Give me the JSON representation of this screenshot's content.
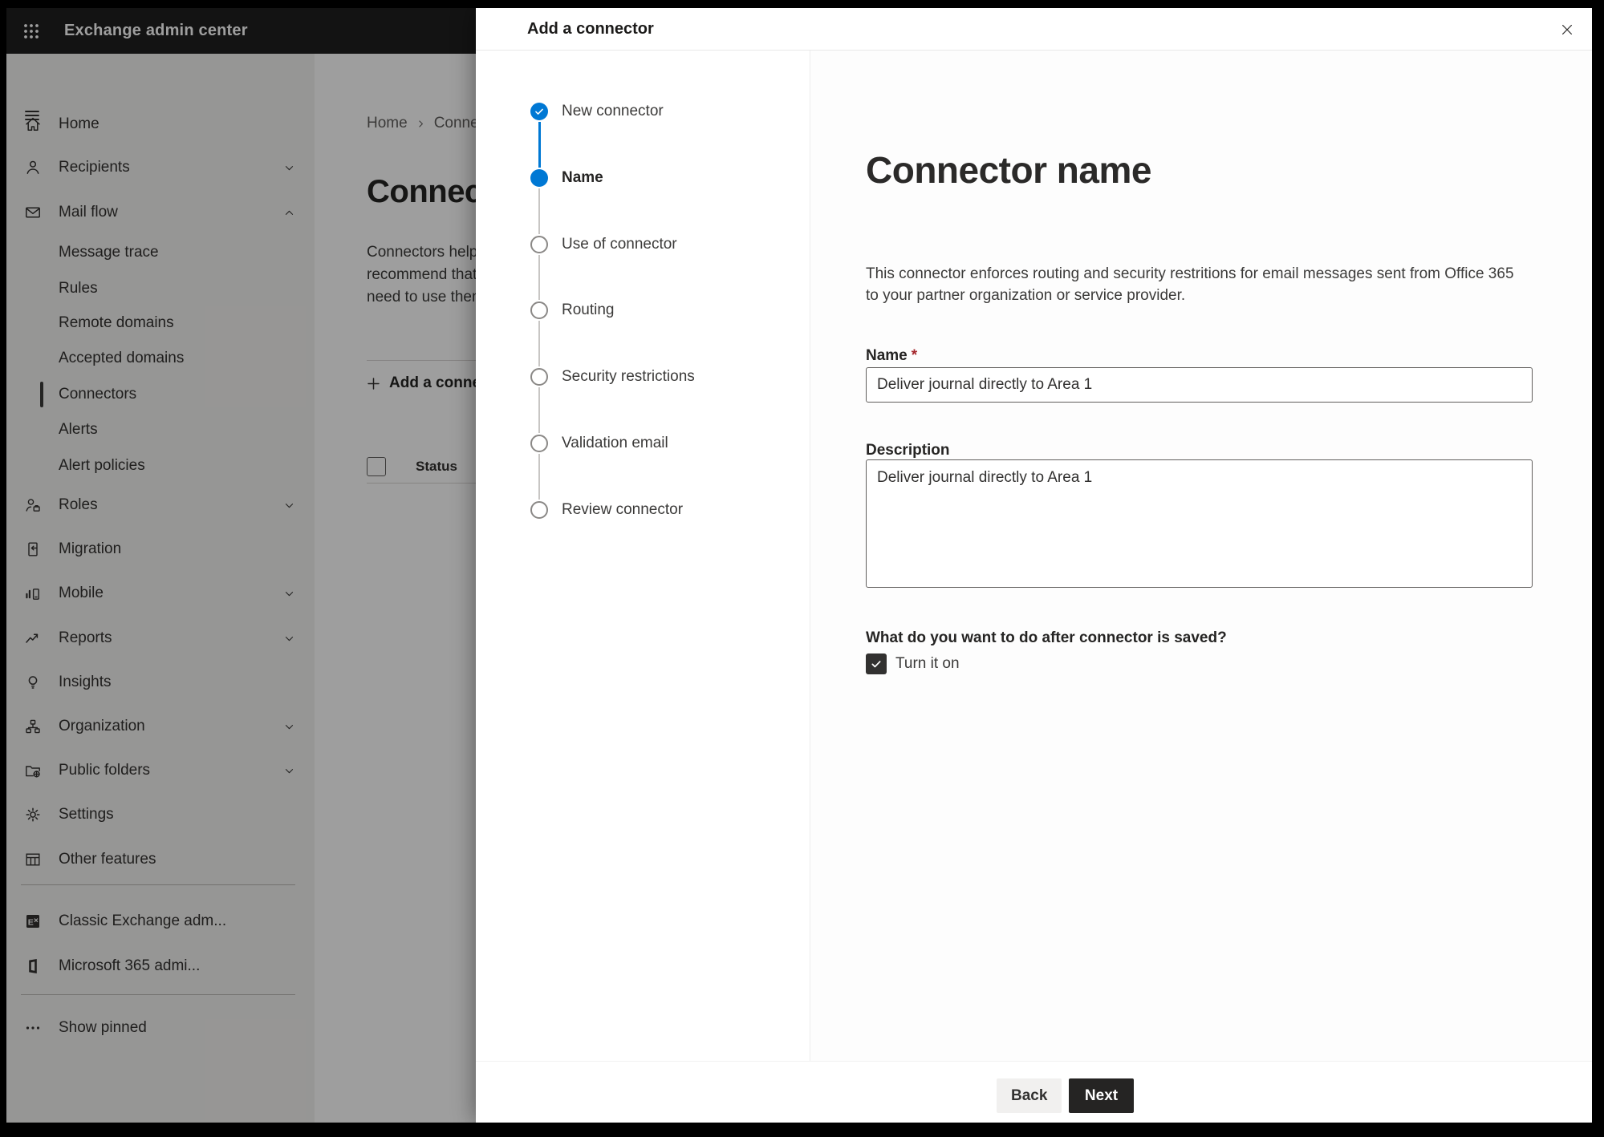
{
  "colors": {
    "accent": "#0078d4",
    "required": "#a4262c",
    "checkbox_bg": "#323130",
    "next_button_bg": "#252423",
    "back_button_bg": "#f1f0ef",
    "topbar_bg": "#1f1f1f",
    "sidebar_bg": "#f3f2f1"
  },
  "top_bar": {
    "title": "Exchange admin center"
  },
  "sidebar": {
    "items": [
      {
        "label": "Home",
        "icon": "home-icon",
        "type": "item"
      },
      {
        "label": "Recipients",
        "icon": "person-icon",
        "type": "item",
        "chevron": "down"
      },
      {
        "label": "Mail flow",
        "icon": "mail-icon",
        "type": "item",
        "chevron": "up"
      },
      {
        "label": "Message trace",
        "type": "sub"
      },
      {
        "label": "Rules",
        "type": "sub"
      },
      {
        "label": "Remote domains",
        "type": "sub"
      },
      {
        "label": "Accepted domains",
        "type": "sub"
      },
      {
        "label": "Connectors",
        "type": "sub",
        "selected": true
      },
      {
        "label": "Alerts",
        "type": "sub"
      },
      {
        "label": "Alert policies",
        "type": "sub"
      },
      {
        "label": "Roles",
        "icon": "roles-icon",
        "type": "item",
        "chevron": "down"
      },
      {
        "label": "Migration",
        "icon": "migration-icon",
        "type": "item"
      },
      {
        "label": "Mobile",
        "icon": "mobile-icon",
        "type": "item",
        "chevron": "down"
      },
      {
        "label": "Reports",
        "icon": "reports-icon",
        "type": "item",
        "chevron": "down"
      },
      {
        "label": "Insights",
        "icon": "insights-icon",
        "type": "item"
      },
      {
        "label": "Organization",
        "icon": "organization-icon",
        "type": "item",
        "chevron": "down"
      },
      {
        "label": "Public folders",
        "icon": "public-folders-icon",
        "type": "item",
        "chevron": "down"
      },
      {
        "label": "Settings",
        "icon": "settings-icon",
        "type": "item"
      },
      {
        "label": "Other features",
        "icon": "other-features-icon",
        "type": "item"
      },
      {
        "type": "divider"
      },
      {
        "label": "Classic Exchange adm...",
        "icon": "classic-exchange-icon",
        "type": "item"
      },
      {
        "label": "Microsoft 365 admi...",
        "icon": "m365-icon",
        "type": "item"
      },
      {
        "type": "divider"
      },
      {
        "label": "Show pinned",
        "icon": "ellipsis-icon",
        "type": "item"
      }
    ]
  },
  "page": {
    "breadcrumb": {
      "home": "Home",
      "current": "Connectors"
    },
    "title": "Connectors",
    "intro_lines": [
      "Connectors help",
      "recommend that",
      "need to use them"
    ],
    "add_button_label": "Add a connector",
    "table": {
      "status_header": "Status"
    }
  },
  "dialog": {
    "title": "Add a connector",
    "steps": [
      {
        "label": "New connector",
        "state": "complete"
      },
      {
        "label": "Name",
        "state": "current"
      },
      {
        "label": "Use of connector",
        "state": "upcoming"
      },
      {
        "label": "Routing",
        "state": "upcoming"
      },
      {
        "label": "Security restrictions",
        "state": "upcoming"
      },
      {
        "label": "Validation email",
        "state": "upcoming"
      },
      {
        "label": "Review connector",
        "state": "upcoming"
      }
    ],
    "content": {
      "heading": "Connector name",
      "intro_lines": [
        "This connector enforces routing and security restritions for email messages sent from Office 365",
        "to your partner organization or service provider."
      ],
      "name_label": "Name",
      "required_marker": "*",
      "name_value": "Deliver journal directly to Area 1",
      "description_label": "Description",
      "description_value": "Deliver journal directly to Area 1",
      "question": "What do you want to do after connector is saved?",
      "checkbox_label": "Turn it on",
      "checkbox_checked": true
    },
    "footer": {
      "back_label": "Back",
      "next_label": "Next"
    }
  }
}
